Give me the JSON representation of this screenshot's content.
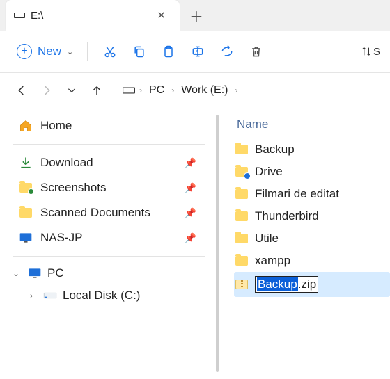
{
  "tab": {
    "title": "E:\\"
  },
  "toolbar": {
    "new_label": "New",
    "sort_fragment": "S"
  },
  "breadcrumbs": {
    "pc": "PC",
    "drive": "Work (E:)"
  },
  "sidebar": {
    "home": "Home",
    "quick": [
      {
        "label": "Download"
      },
      {
        "label": "Screenshots"
      },
      {
        "label": "Scanned Documents"
      },
      {
        "label": "NAS-JP"
      }
    ],
    "pc": "PC",
    "local_disk": "Local Disk (C:)"
  },
  "main": {
    "column_name": "Name",
    "items": [
      {
        "label": "Backup"
      },
      {
        "label": "Drive"
      },
      {
        "label": "Filmari de editat"
      },
      {
        "label": "Thunderbird"
      },
      {
        "label": "Utile"
      },
      {
        "label": "xampp"
      }
    ],
    "rename": {
      "selected": "Backup",
      "rest": ".zip"
    }
  }
}
